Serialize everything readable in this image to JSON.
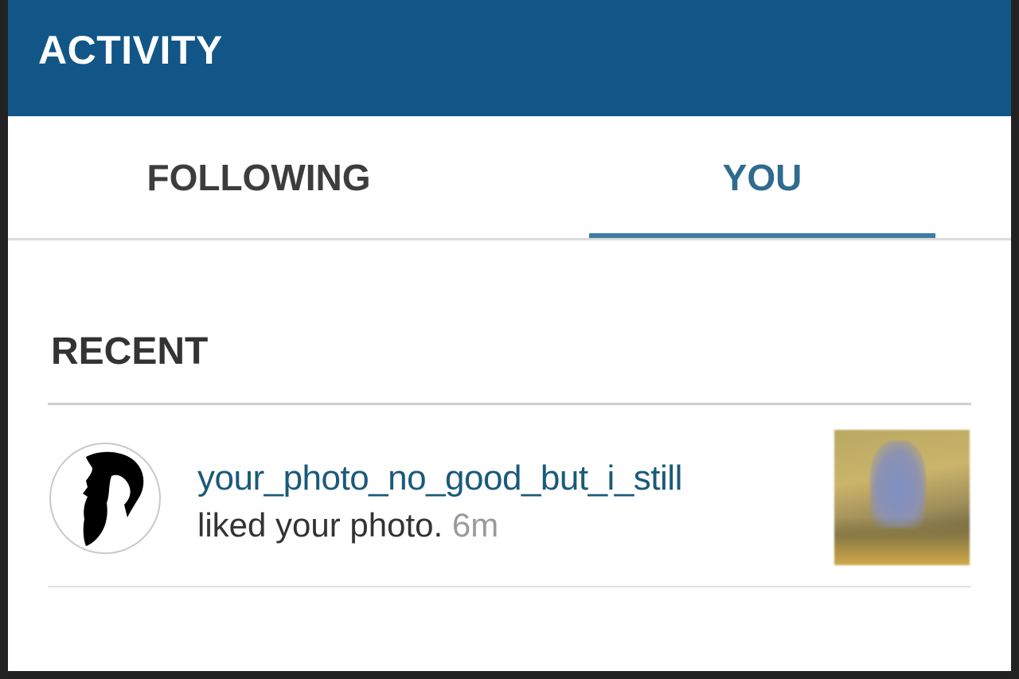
{
  "header": {
    "title": "ACTIVITY"
  },
  "tabs": [
    {
      "label": "FOLLOWING",
      "active": false
    },
    {
      "label": "YOU",
      "active": true
    }
  ],
  "section": {
    "title": "RECENT"
  },
  "activity": [
    {
      "username": "your_photo_no_good_but_i_still",
      "action": "liked your photo.",
      "time": "6m",
      "avatar_icon": "bearded-man-silhouette-icon",
      "thumbnail": "blurred-photo-thumbnail"
    }
  ],
  "colors": {
    "header_bg": "#125688",
    "active_tab": "#2f6b8f",
    "username": "#1a5a7a",
    "timestamp": "#9a9a9a"
  }
}
